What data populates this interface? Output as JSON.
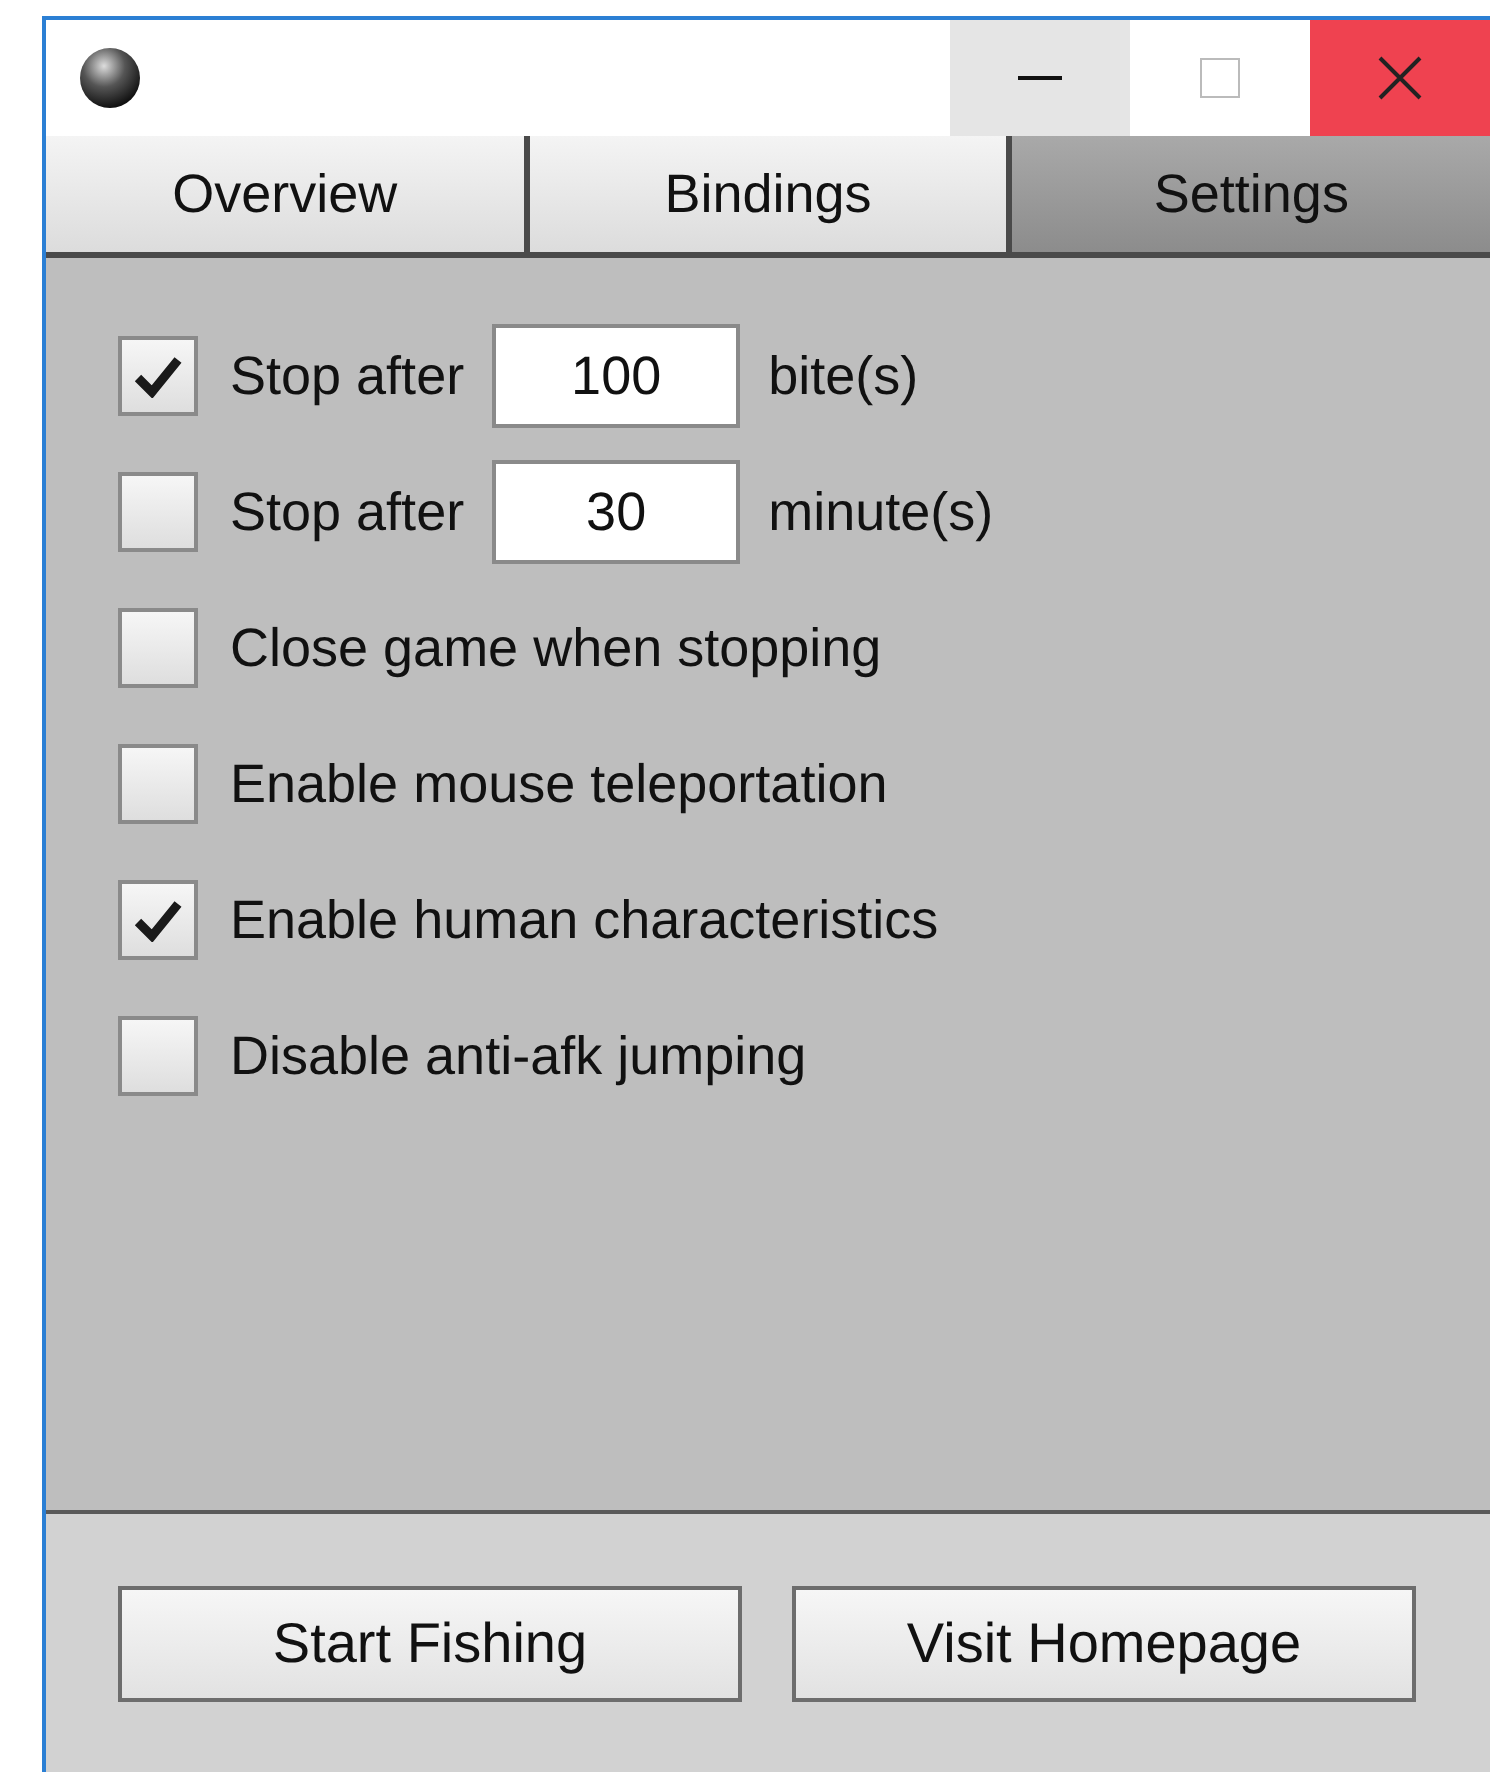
{
  "tabs": [
    {
      "label": "Overview",
      "selected": false
    },
    {
      "label": "Bindings",
      "selected": false
    },
    {
      "label": "Settings",
      "selected": true
    }
  ],
  "options": [
    {
      "kind": "count",
      "checked": true,
      "label": "Stop after",
      "value": "100",
      "unit": "bite(s)"
    },
    {
      "kind": "count",
      "checked": false,
      "label": "Stop after",
      "value": "30",
      "unit": "minute(s)"
    },
    {
      "kind": "plain",
      "checked": false,
      "label": "Close game when stopping"
    },
    {
      "kind": "plain",
      "checked": false,
      "label": "Enable mouse teleportation"
    },
    {
      "kind": "plain",
      "checked": true,
      "label": "Enable human characteristics"
    },
    {
      "kind": "plain",
      "checked": false,
      "label": "Disable anti-afk jumping"
    }
  ],
  "buttons": [
    "Start Fishing",
    "Visit Homepage"
  ]
}
